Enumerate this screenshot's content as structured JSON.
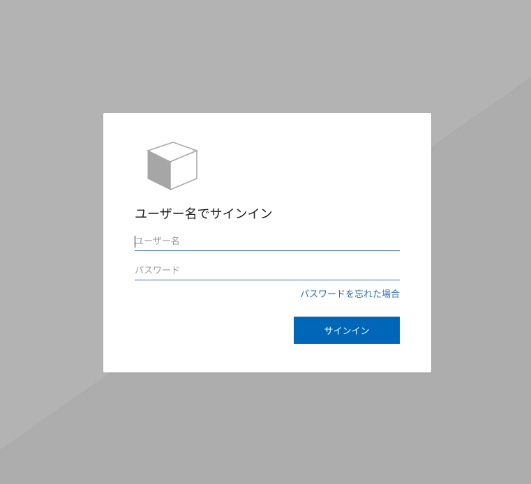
{
  "login": {
    "logo_icon": "cube-icon",
    "heading": "ユーザー名でサインイン",
    "username_placeholder": "ユーザー名",
    "username_value": "",
    "password_placeholder": "パスワード",
    "password_value": "",
    "forgot_password_link": "パスワードを忘れた場合",
    "signin_button": "サインイン"
  },
  "colors": {
    "background": "#adadad",
    "card": "#ffffff",
    "accent": "#0067b8",
    "link": "#2f6fb0",
    "input_underline": "#3a6ea5"
  }
}
